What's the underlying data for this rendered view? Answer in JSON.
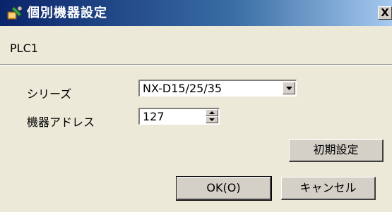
{
  "window": {
    "title": "個別機器設定",
    "close_symbol": "X",
    "icon": "settings-wrench-icon"
  },
  "device": {
    "name": "PLC1"
  },
  "fields": {
    "series_label": "シリーズ",
    "series_value": "NX-D15/25/35",
    "address_label": "機器アドレス",
    "address_value": "127"
  },
  "buttons": {
    "initial_settings": "初期設定",
    "ok": "OK(O)",
    "cancel": "キャンセル"
  },
  "colors": {
    "title_gradient_start": "#0a246a",
    "title_gradient_end": "#a6caf0",
    "dialog_background": "#ece9d8"
  }
}
